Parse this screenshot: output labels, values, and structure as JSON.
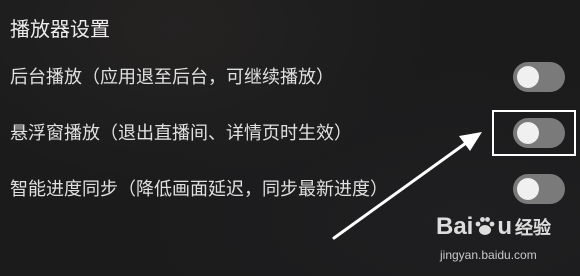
{
  "section": {
    "title": "播放器设置"
  },
  "settings": [
    {
      "label": "后台播放（应用退至后台，可继续播放）",
      "enabled": false
    },
    {
      "label": "悬浮窗播放（退出直播间、详情页时生效）",
      "enabled": false
    },
    {
      "label": "智能进度同步（降低画面延迟，同步最新进度）",
      "enabled": false
    }
  ],
  "colors": {
    "background": "#1b1b1c",
    "toggle_off_track": "#7a7a7a",
    "toggle_knob": "#f0f0f0",
    "annotation": "#ffffff"
  },
  "annotation": {
    "highlight_target": "settings.1.toggle",
    "arrow_icon": "arrow-up-right-icon"
  },
  "watermark": {
    "logo_text_1": "Bai",
    "logo_text_2": "u",
    "logo_suffix": "经验",
    "url": "jingyan.baidu.com"
  }
}
